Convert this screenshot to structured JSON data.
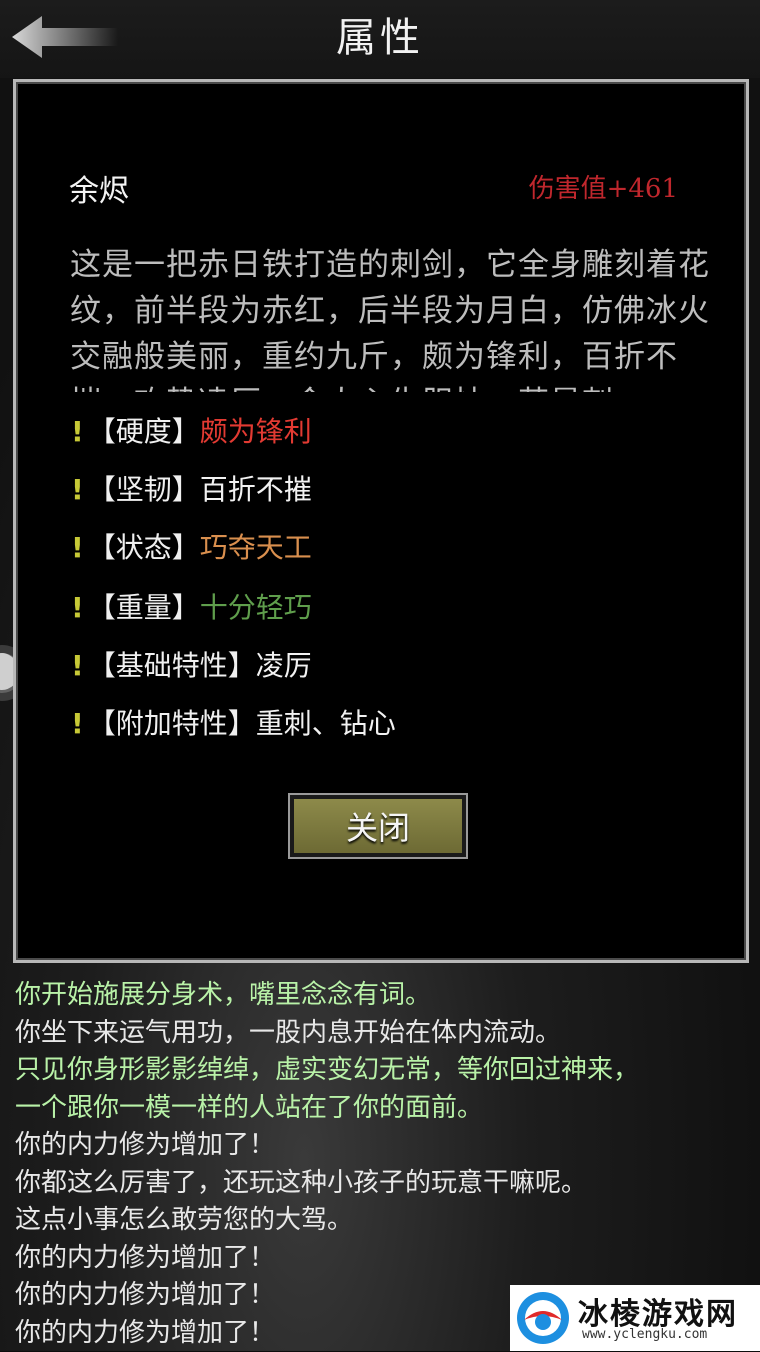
{
  "header": {
    "title": "属性",
    "back_icon": "arrow-left-icon"
  },
  "item": {
    "name": "余烬",
    "damage": "伤害值+461",
    "description": "这是一把赤日铁打造的刺剑，它全身雕刻着花纹，前半段为赤红，后半段为月白，仿佛冰火交融般美丽，重约九斤，颇为锋利，百折不摧，攻势凌厉，令人心生胆怯，若是刺"
  },
  "attributes": [
    {
      "marker": "!",
      "key": "【硬度】",
      "value": "颇为锋利",
      "color": "#e23a32"
    },
    {
      "marker": "!",
      "key": "【坚韧】",
      "value": "百折不摧",
      "color": "#f2f2f2"
    },
    {
      "marker": "!",
      "key": "【状态】",
      "value": "巧夺天工",
      "color": "#d98f4e"
    },
    {
      "marker": "!",
      "key": "【重量】",
      "value": "十分轻巧",
      "color": "#5f9e4c"
    },
    {
      "marker": "!",
      "key": "【基础特性】",
      "value": "凌厉",
      "color": "#f2f2f2"
    },
    {
      "marker": "!",
      "key": "【附加特性】",
      "value": "重刺、钻心",
      "color": "#f2f2f2"
    }
  ],
  "close_button": {
    "label": "关闭"
  },
  "log": [
    {
      "text": "你开始施展分身术，嘴里念念有词。",
      "color": "#b9f2a8"
    },
    {
      "text": "你坐下来运气用功，一股内息开始在体内流动。",
      "color": "#e8e8e8"
    },
    {
      "text": "只见你身形影影绰绰，虚实变幻无常，等你回过神来，",
      "color": "#b9f2a8"
    },
    {
      "text": "一个跟你一模一样的人站在了你的面前。",
      "color": "#b9f2a8"
    },
    {
      "text": "你的内力修为增加了！",
      "color": "#e8e8e8"
    },
    {
      "text": "你都这么厉害了，还玩这种小孩子的玩意干嘛呢。",
      "color": "#e8e8e8"
    },
    {
      "text": "这点小事怎么敢劳您的大驾。",
      "color": "#e8e8e8"
    },
    {
      "text": "你的内力修为增加了！",
      "color": "#e8e8e8"
    },
    {
      "text": "你的内力修为增加了！",
      "color": "#e8e8e8"
    },
    {
      "text": "你的内力修为增加了！",
      "color": "#e8e8e8"
    }
  ],
  "watermark": {
    "title": "冰棱游戏网",
    "url": "www.yclengku.com",
    "logo": "ice-logo-icon"
  }
}
